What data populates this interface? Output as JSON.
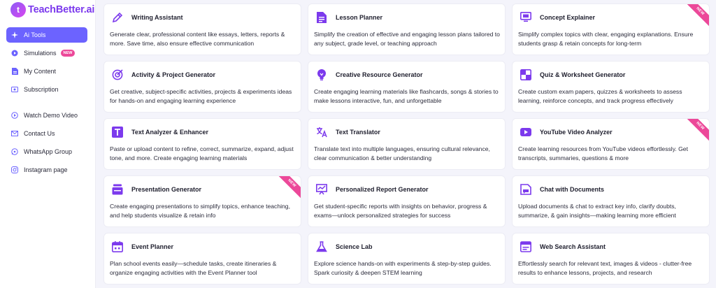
{
  "brand": {
    "name": "TeachBetter.ai",
    "logo_text": "t"
  },
  "colors": {
    "accent": "#6c63ff",
    "brand": "#7c3aed",
    "badge": "#ec4899"
  },
  "sidebar": {
    "items": [
      {
        "label": "Ai Tools",
        "icon": "sparkle-icon",
        "active": true
      },
      {
        "label": "Simulations",
        "icon": "play-circle-icon",
        "badge": "NEW"
      },
      {
        "label": "My Content",
        "icon": "document-icon"
      },
      {
        "label": "Subscription",
        "icon": "card-icon"
      }
    ],
    "links": [
      {
        "label": "Watch Demo Video",
        "icon": "play-circle-icon"
      },
      {
        "label": "Contact Us",
        "icon": "mail-icon"
      },
      {
        "label": "WhatsApp Group",
        "icon": "whatsapp-icon"
      },
      {
        "label": "Instagram page",
        "icon": "instagram-icon"
      }
    ]
  },
  "tools": [
    {
      "title": "Writing Assistant",
      "icon": "pencil-icon",
      "desc": "Generate clear, professional content like essays, letters, reports & more. Save time, also ensure effective communication"
    },
    {
      "title": "Lesson Planner",
      "icon": "document-icon",
      "desc": "Simplify the creation of effective and engaging lesson plans tailored to any subject, grade level, or teaching approach"
    },
    {
      "title": "Concept Explainer",
      "icon": "monitor-icon",
      "desc": "Simplify complex topics with clear, engaging explanations. Ensure students grasp & retain concepts for long-term",
      "ribbon": "NEW"
    },
    {
      "title": "Activity & Project Generator",
      "icon": "target-icon",
      "desc": "Get creative, subject-specific activities, projects & experiments ideas for hands-on and engaging learning experience"
    },
    {
      "title": "Creative Resource Generator",
      "icon": "bulb-icon",
      "desc": "Create engaging learning materials like flashcards, songs & stories to make lessons interactive, fun, and unforgettable"
    },
    {
      "title": "Quiz & Worksheet Generator",
      "icon": "grid-icon",
      "desc": "Create custom exam papers, quizzes & worksheets to assess learning, reinforce concepts, and track progress effectively"
    },
    {
      "title": "Text Analyzer & Enhancer",
      "icon": "text-icon",
      "desc": "Paste or upload content to refine, correct, summarize, expand, adjust tone, and more. Create engaging learning materials"
    },
    {
      "title": "Text Translator",
      "icon": "translate-icon",
      "desc": "Translate text into multiple languages, ensuring cultural relevance, clear communication & better understanding"
    },
    {
      "title": "YouTube Video Analyzer",
      "icon": "youtube-icon",
      "desc": "Create learning resources from YouTube videos effortlessly. Get transcripts, summaries, questions & more",
      "ribbon": "NEW"
    },
    {
      "title": "Presentation Generator",
      "icon": "slides-icon",
      "desc": "Create engaging presentations to simplify topics, enhance teaching, and help students visualize & retain info",
      "ribbon": "NEW"
    },
    {
      "title": "Personalized Report Generator",
      "icon": "chart-board-icon",
      "desc": "Get student-specific reports with insights on behavior, progress & exams—unlock personalized strategies for success"
    },
    {
      "title": "Chat with Documents",
      "icon": "chat-doc-icon",
      "desc": "Upload documents & chat to extract key info, clarify doubts, summarize, & gain insights—making learning more efficient"
    },
    {
      "title": "Event Planner",
      "icon": "calendar-icon",
      "desc": "Plan school events easily—schedule tasks, create itineraries & organize engaging activities with the Event Planner tool"
    },
    {
      "title": "Science Lab",
      "icon": "flask-icon",
      "desc": "Explore science hands-on with experiments & step-by-step guides. Spark curiosity & deepen STEM learning"
    },
    {
      "title": "Web Search Assistant",
      "icon": "browser-icon",
      "desc": "Effortlessly search for relevant text, images & videos - clutter-free results to enhance lessons, projects, and research"
    }
  ]
}
